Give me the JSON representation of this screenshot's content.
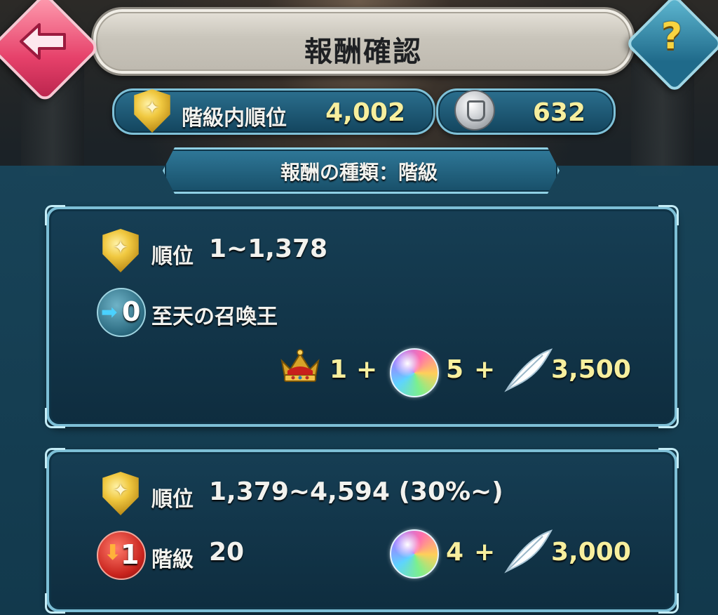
{
  "header": {
    "title": "報酬確認",
    "back_icon": "left-arrow-icon",
    "help_label": "?"
  },
  "stats": {
    "rank_label": "階級内順位",
    "rank_value": "4,002",
    "score_value": "632"
  },
  "reward_type": {
    "label": "報酬の種類：階級"
  },
  "reward_tiers": [
    {
      "rank_label": "順位",
      "rank_range": "1~1,378",
      "change_value": "0",
      "change_direction": "up",
      "tier_name": "至天の召喚王",
      "items": [
        {
          "icon": "crown-icon",
          "amount": "1"
        },
        {
          "icon": "orb-icon",
          "amount": "5"
        },
        {
          "icon": "feather-icon",
          "amount": "3,500"
        }
      ]
    },
    {
      "rank_label": "順位",
      "rank_range": "1,379~4,594 (30%~)",
      "change_value": "1",
      "change_direction": "down",
      "tier_label": "階級",
      "tier_value": "20",
      "items": [
        {
          "icon": "orb-icon",
          "amount": "4"
        },
        {
          "icon": "feather-icon",
          "amount": "3,000"
        }
      ]
    }
  ],
  "separator": "+",
  "colors": {
    "accent_gold": "#f7ef9e",
    "panel_border": "#7dbfd6",
    "back_button": "#e6416a"
  }
}
